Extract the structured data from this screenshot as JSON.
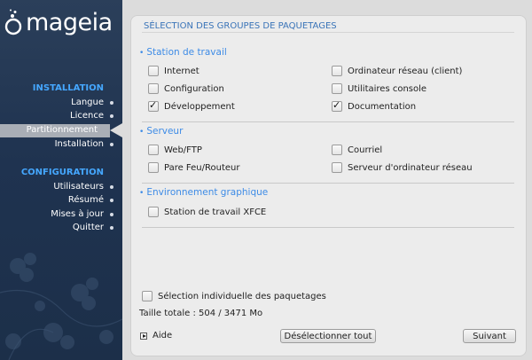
{
  "brand": {
    "name": "mageia"
  },
  "sidebar": {
    "heading_install": "INSTALLATION",
    "install_items": [
      {
        "label": "Langue"
      },
      {
        "label": "Licence"
      },
      {
        "label": "Partitionnement",
        "current": true
      },
      {
        "label": "Installation"
      }
    ],
    "heading_config": "CONFIGURATION",
    "config_items": [
      {
        "label": "Utilisateurs"
      },
      {
        "label": "Résumé"
      },
      {
        "label": "Mises à jour"
      },
      {
        "label": "Quitter"
      }
    ]
  },
  "panel": {
    "title": "SÉLECTION DES GROUPES DE PAQUETAGES",
    "sections": [
      {
        "label": "Station de travail",
        "groups": [
          {
            "label": "Internet",
            "checked": false
          },
          {
            "label": "Ordinateur réseau (client)",
            "checked": false
          },
          {
            "label": "Configuration",
            "checked": false
          },
          {
            "label": "Utilitaires console",
            "checked": false
          },
          {
            "label": "Développement",
            "checked": true
          },
          {
            "label": "Documentation",
            "checked": true
          }
        ]
      },
      {
        "label": "Serveur",
        "groups": [
          {
            "label": "Web/FTP",
            "checked": false
          },
          {
            "label": "Courriel",
            "checked": false
          },
          {
            "label": "Pare Feu/Routeur",
            "checked": false
          },
          {
            "label": "Serveur d'ordinateur réseau",
            "checked": false
          }
        ]
      },
      {
        "label": "Environnement graphique",
        "groups": [
          {
            "label": "Station de travail XFCE",
            "checked": false
          }
        ]
      }
    ],
    "individual_selection": {
      "label": "Sélection individuelle des paquetages",
      "checked": false
    },
    "total_size": "Taille totale : 504 / 3471 Mo"
  },
  "buttons": {
    "help": "Aide",
    "deselect_all": "Désélectionner tout",
    "next": "Suivant"
  },
  "colors": {
    "sidebar_bg": "#1f3350",
    "heading_blue": "#45a7ff",
    "section_blue": "#3d8be6",
    "panel_bg": "#ececec"
  }
}
